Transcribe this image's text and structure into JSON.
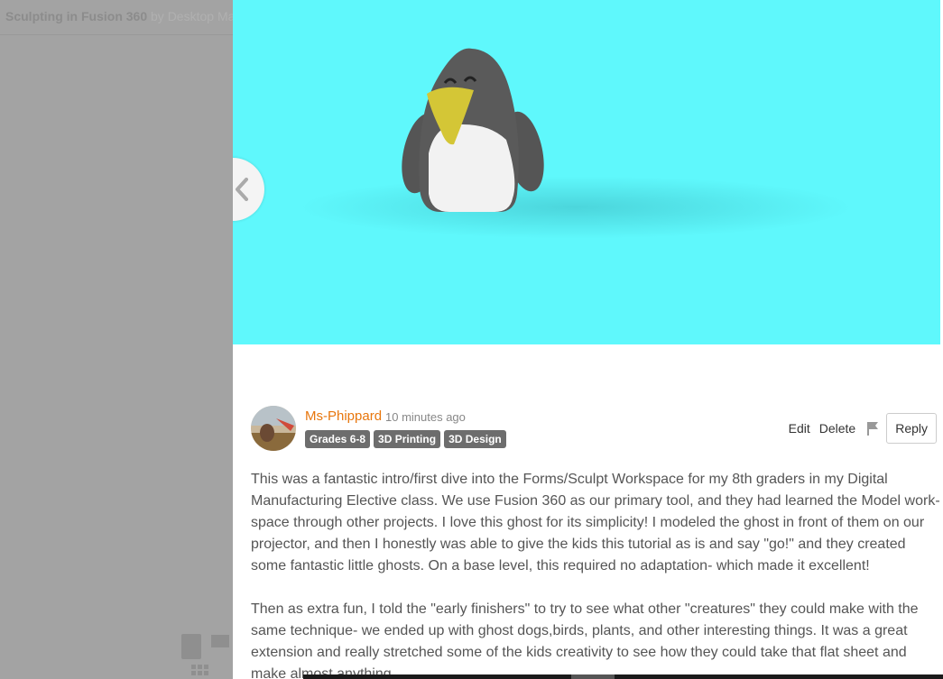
{
  "background": {
    "title": "Sculpting in Fusion 360",
    "by_text": "by Desktop Ma"
  },
  "hero": {
    "bg_color": "#5ff8fc",
    "image_subject": "penguin-render"
  },
  "comment": {
    "author": "Ms-Phippard",
    "time": "10 minutes ago",
    "tags": [
      "Grades 6-8",
      "3D Printing",
      "3D Design"
    ],
    "actions": {
      "edit": "Edit",
      "delete": "Delete",
      "reply": "Reply"
    },
    "paragraphs": [
      "This was a fantastic intro/first dive into the Forms/Sculpt Workspace for my 8th graders in my Digital Manufacturing Elective class. We use Fusion 360 as our primary tool, and they had learned the Model work-space through other projects. I love this ghost for its simplicity! I modeled the ghost in front of them on our projector, and then I honestly was able to give the kids this tutorial as is and say \"go!\" and they created some fantastic little ghosts. On a base level, this required no adaptation- which made it excellent!",
      "Then as extra fun, I told the \"early finishers\" to try to see what other \"creatures\" they could make with the same technique- we ended up with ghost dogs,birds, plants, and other interesting things. It was a great extension and really stretched some of the kids creativity to see how they could take that flat sheet and make almost anything."
    ]
  },
  "colors": {
    "author": "#e8760c",
    "tag_bg": "#6d6d6d"
  }
}
